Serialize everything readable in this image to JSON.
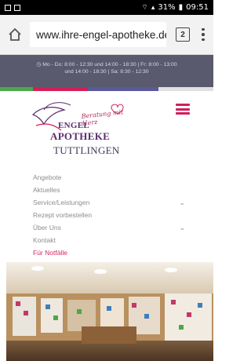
{
  "status_bar": {
    "battery": "31%",
    "time": "09:51"
  },
  "browser": {
    "url": "www.ihre-engel-apotheke.de",
    "tab_count": "2"
  },
  "hours": {
    "line1": "◷ Mo - Do: 8:00 - 12:30 und 14:00 - 18:30 | Fr: 8:00 - 13:00",
    "line2": "und 14:00 - 18:30 | Sa: 8:30 - 12:30"
  },
  "logo": {
    "tagline": "Beratung mit Herz",
    "line1": "ENGEL",
    "line2": "APOTHEKE",
    "line3": "TUTTLINGEN"
  },
  "nav": {
    "items": [
      {
        "label": "Angebote"
      },
      {
        "label": "Aktuelles"
      },
      {
        "label": "Service/Leistungen"
      },
      {
        "label": "Rezept vorbestellen"
      },
      {
        "label": "Über Uns"
      },
      {
        "label": "Kontakt"
      },
      {
        "label": "Für Notfälle"
      }
    ]
  },
  "icons": {
    "home": "home-icon",
    "overflow": "more-vert-icon",
    "menu": "hamburger-menu-icon",
    "chevron": "chevron-down-icon"
  },
  "colors": {
    "accent": "#d21f5a",
    "banner": "#5a5a6e",
    "stripe": [
      "#4aa84a",
      "#d21f5a",
      "#5a5a9a",
      "#e0e0e0"
    ]
  }
}
